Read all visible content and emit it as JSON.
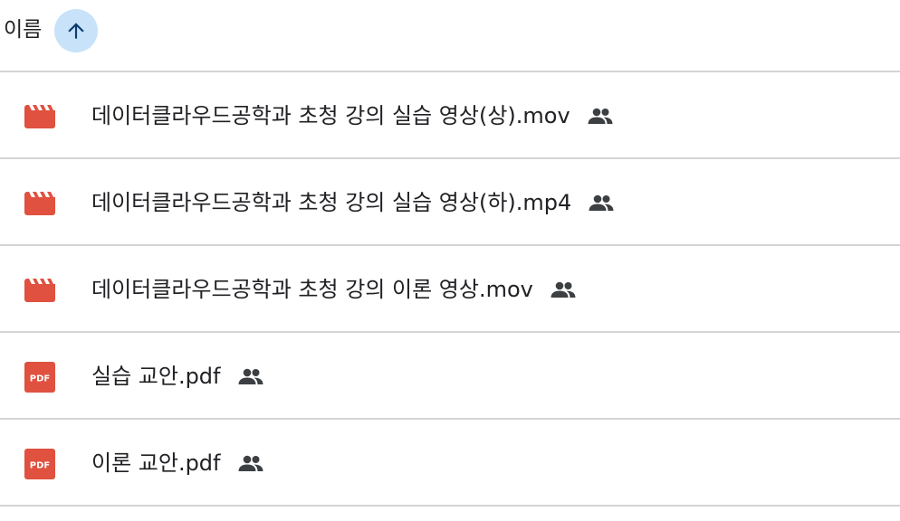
{
  "header": {
    "column_label": "이름",
    "sort_icon": "arrow-upward-icon",
    "sort_direction": "ascending"
  },
  "colors": {
    "video_icon": "#e0513f",
    "pdf_icon": "#e0513f",
    "sort_button_bg": "#c7e2f9",
    "sort_arrow": "#0b3d6e",
    "divider": "#d4d4d4",
    "shared_icon": "#3c4043"
  },
  "files": [
    {
      "name": "데이터클라우드공학과 초청 강의 실습 영상(상).mov",
      "type_icon": "video-icon",
      "shared_icon": "people-icon"
    },
    {
      "name": "데이터클라우드공학과 초청 강의 실습 영상(하).mp4",
      "type_icon": "video-icon",
      "shared_icon": "people-icon"
    },
    {
      "name": "데이터클라우드공학과 초청 강의 이론 영상.mov",
      "type_icon": "video-icon",
      "shared_icon": "people-icon"
    },
    {
      "name": "실습 교안.pdf",
      "type_icon": "pdf-icon",
      "pdf_label": "PDF",
      "shared_icon": "people-icon"
    },
    {
      "name": "이론 교안.pdf",
      "type_icon": "pdf-icon",
      "pdf_label": "PDF",
      "shared_icon": "people-icon"
    }
  ]
}
